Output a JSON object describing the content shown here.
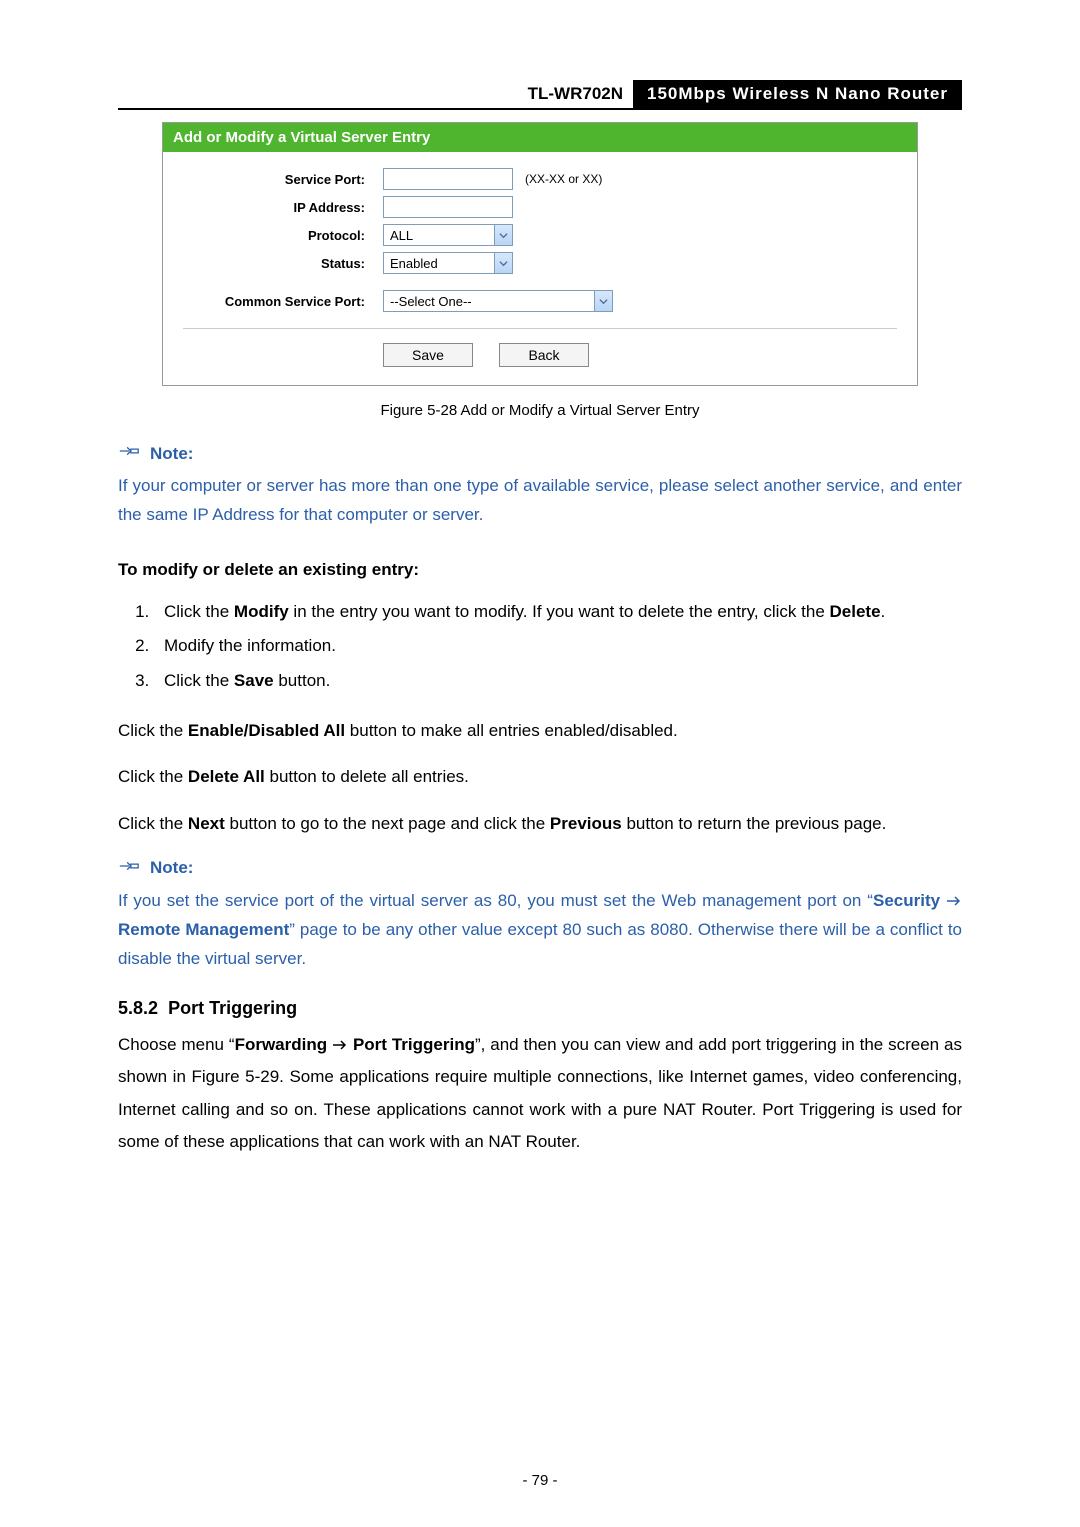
{
  "header": {
    "model": "TL-WR702N",
    "desc": "150Mbps Wireless N Nano Router"
  },
  "panel": {
    "title": "Add or Modify a Virtual Server Entry",
    "labels": {
      "service_port": "Service Port:",
      "ip_address": "IP Address:",
      "protocol": "Protocol:",
      "status": "Status:",
      "common_service_port": "Common Service Port:"
    },
    "hints": {
      "port_format": "(XX-XX or XX)"
    },
    "values": {
      "protocol": "ALL",
      "status": "Enabled",
      "common_service_port": "--Select One--"
    },
    "buttons": {
      "save": "Save",
      "back": "Back"
    }
  },
  "figure_caption": "Figure 5-28    Add or Modify a Virtual Server Entry",
  "notes": {
    "label": "Note:",
    "note1": "If your computer or server has more than one type of available service, please select another service, and enter the same IP Address for that computer or server.",
    "note2_a": "If you set the service port of the virtual server as 80, you must set the Web management port on “",
    "note2_sec": "Security",
    "note2_rm": " Remote Management",
    "note2_b": "” page to be any other value except 80 such as 8080. Otherwise there will be a conflict to disable the virtual server."
  },
  "modify_heading": "To modify or delete an existing entry:",
  "steps": {
    "s1a": "Click the ",
    "s1m": "Modify",
    "s1b": " in the entry you want to modify. If you want to delete the entry, click the ",
    "s1d": "Delete",
    "s1c": ".",
    "s2": "Modify the information.",
    "s3a": "Click the ",
    "s3b": "Save",
    "s3c": " button."
  },
  "paras": {
    "p1a": "Click the ",
    "p1b": "Enable/Disabled All",
    "p1c": " button to make all entries enabled/disabled.",
    "p2a": "Click the ",
    "p2b": "Delete All",
    "p2c": " button to delete all entries.",
    "p3a": "Click the ",
    "p3b": "Next",
    "p3c": " button to go to the next page and click the ",
    "p3d": "Previous",
    "p3e": " button to return the previous page."
  },
  "section": {
    "num": "5.8.2",
    "title": "Port Triggering"
  },
  "section_body": {
    "a": "Choose menu “",
    "fwd": "Forwarding",
    "pt": " Port Triggering",
    "b": "”, and then you can view and add port triggering in the screen as shown in Figure 5-29. Some applications require multiple connections, like Internet games, video conferencing, Internet calling and so on. These applications cannot work with a pure NAT Router. Port Triggering is used for some of these applications that can work with an NAT Router."
  },
  "page_number": "- 79 -"
}
